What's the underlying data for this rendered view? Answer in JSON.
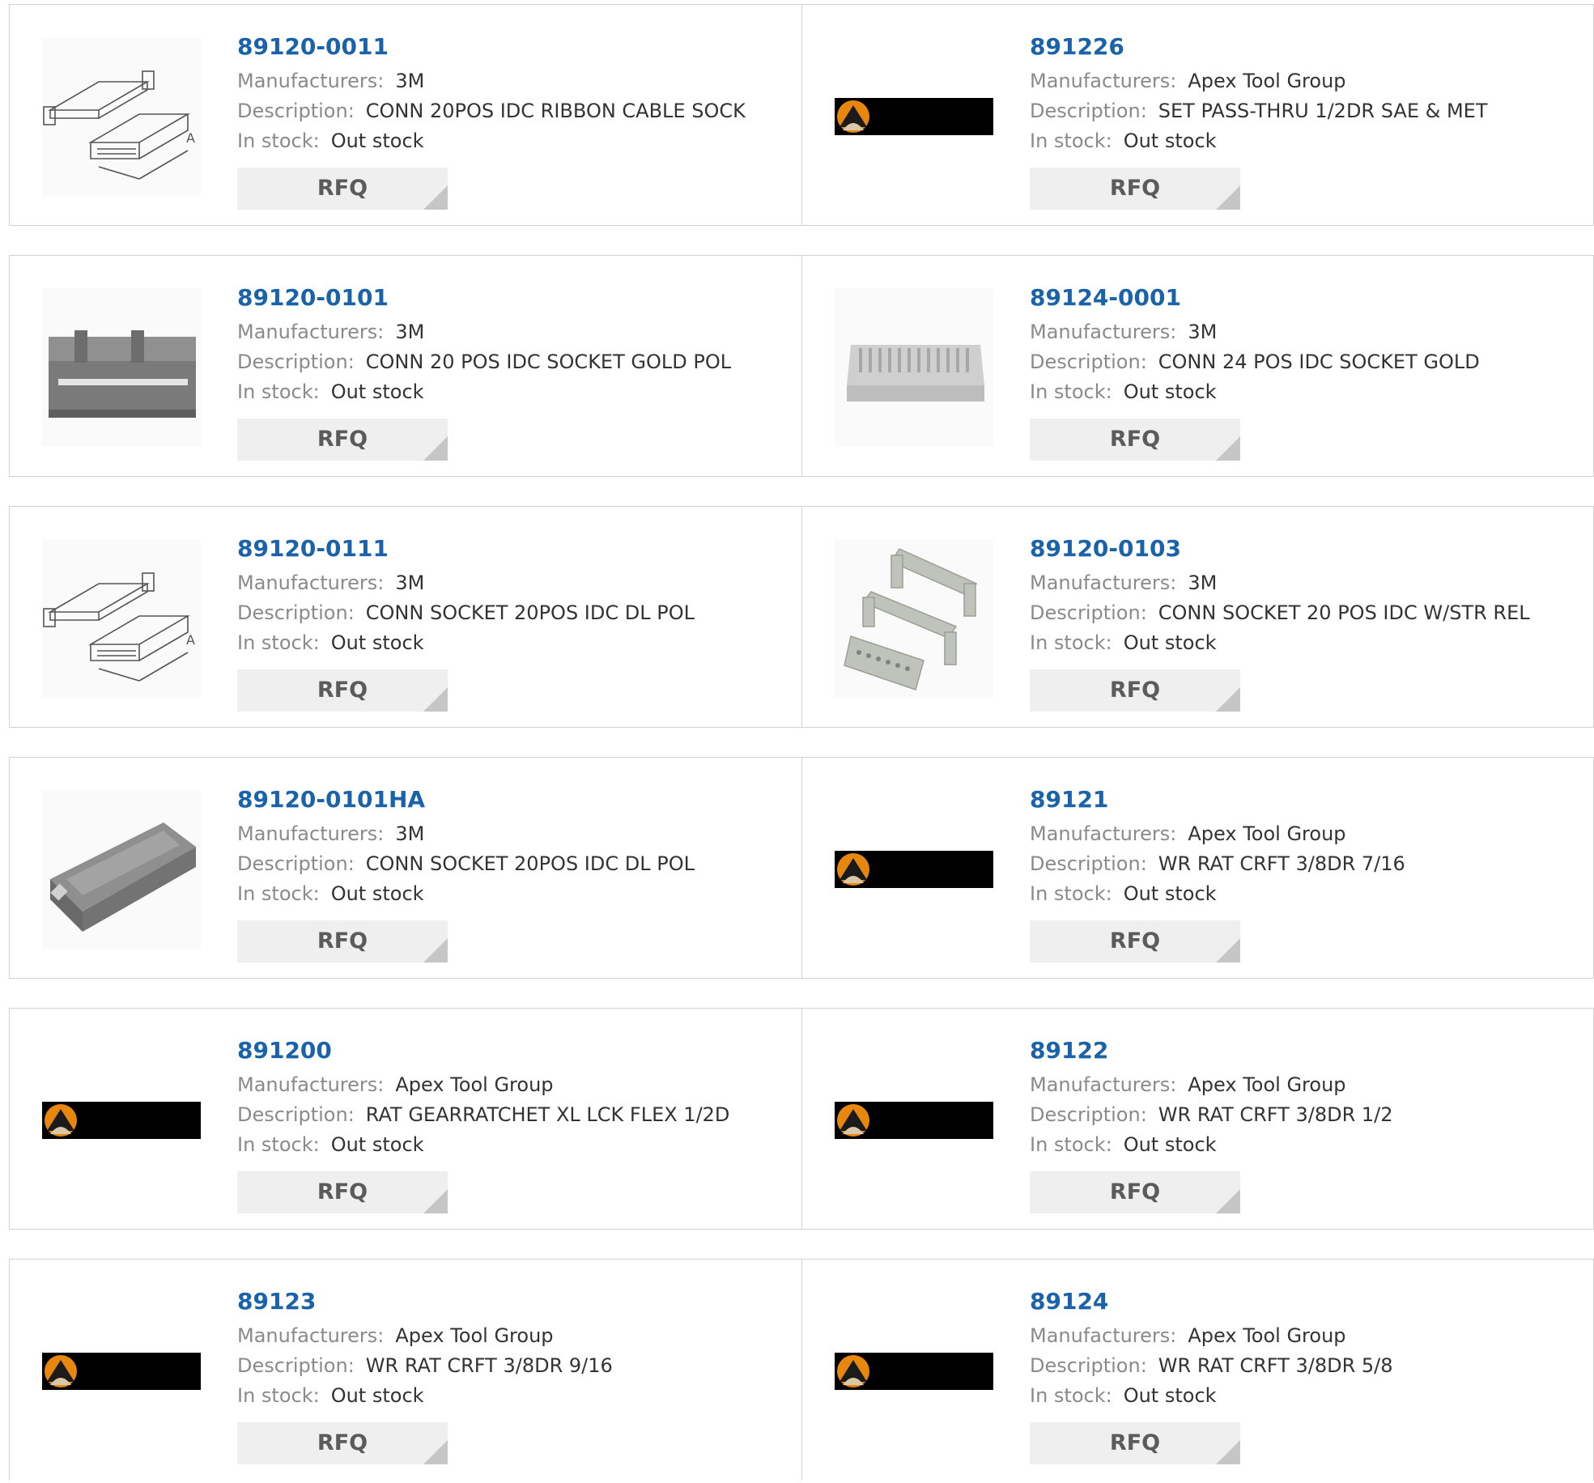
{
  "labels": {
    "manufacturers": "Manufacturers:",
    "description": "Description:",
    "stock": "In stock:",
    "rfq": "RFQ"
  },
  "products": [
    {
      "part": "89120-0011",
      "manufacturer": "3M",
      "description": "CONN 20POS IDC RIBBON CABLE SOCK",
      "stock": "Out stock",
      "image": "idc-drawing"
    },
    {
      "part": "891226",
      "manufacturer": "Apex Tool Group",
      "description": "SET PASS-THRU 1/2DR SAE & MET",
      "stock": "Out stock",
      "image": "apex-logo"
    },
    {
      "part": "89120-0101",
      "manufacturer": "3M",
      "description": "CONN 20 POS IDC SOCKET GOLD POL",
      "stock": "Out stock",
      "image": "idc-socket-dark"
    },
    {
      "part": "89124-0001",
      "manufacturer": "3M",
      "description": "CONN 24 POS IDC SOCKET GOLD",
      "stock": "Out stock",
      "image": "idc-socket-light"
    },
    {
      "part": "89120-0111",
      "manufacturer": "3M",
      "description": "CONN SOCKET 20POS IDC DL POL",
      "stock": "Out stock",
      "image": "idc-drawing"
    },
    {
      "part": "89120-0103",
      "manufacturer": "3M",
      "description": "CONN SOCKET 20 POS IDC W/STR REL",
      "stock": "Out stock",
      "image": "idc-strain-relief"
    },
    {
      "part": "89120-0101HA",
      "manufacturer": "3M",
      "description": "CONN SOCKET 20POS IDC DL POL",
      "stock": "Out stock",
      "image": "idc-socket-angled"
    },
    {
      "part": "89121",
      "manufacturer": "Apex Tool Group",
      "description": "WR RAT CRFT 3/8DR 7/16",
      "stock": "Out stock",
      "image": "apex-logo"
    },
    {
      "part": "891200",
      "manufacturer": "Apex Tool Group",
      "description": "RAT GEARRATCHET XL LCK FLEX 1/2D",
      "stock": "Out stock",
      "image": "apex-logo"
    },
    {
      "part": "89122",
      "manufacturer": "Apex Tool Group",
      "description": "WR RAT CRFT 3/8DR 1/2",
      "stock": "Out stock",
      "image": "apex-logo"
    },
    {
      "part": "89123",
      "manufacturer": "Apex Tool Group",
      "description": "WR RAT CRFT 3/8DR 9/16",
      "stock": "Out stock",
      "image": "apex-logo"
    },
    {
      "part": "89124",
      "manufacturer": "Apex Tool Group",
      "description": "WR RAT CRFT 3/8DR 5/8",
      "stock": "Out stock",
      "image": "apex-logo"
    }
  ]
}
